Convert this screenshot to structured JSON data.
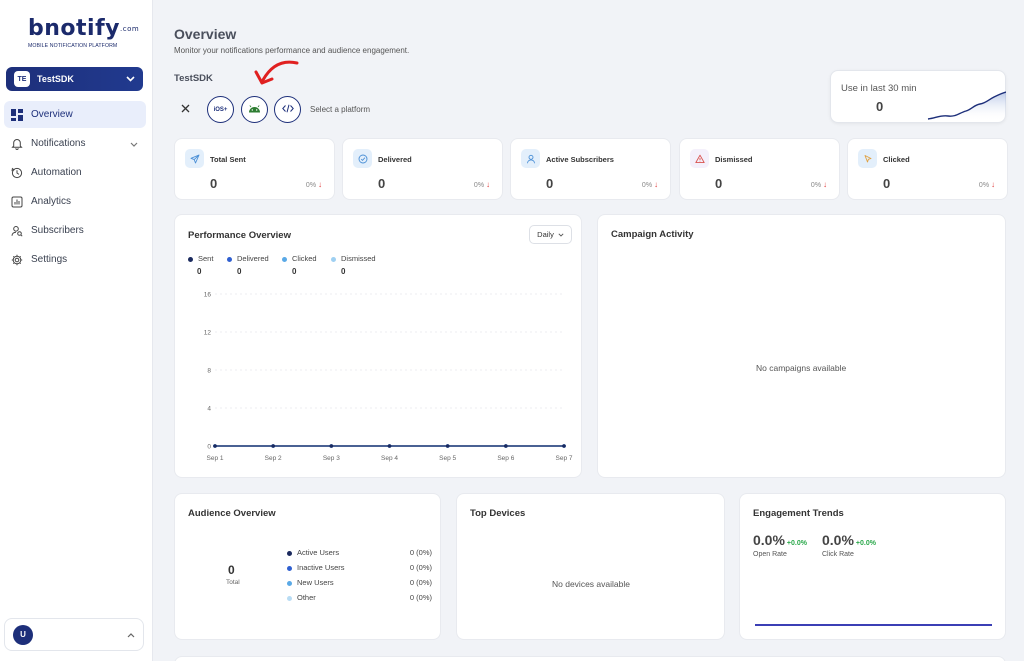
{
  "brand": {
    "logo_text": "bnotify",
    "logo_com": ".com",
    "tagline": "MOBILE NOTIFICATION PLATFORM"
  },
  "workspace": {
    "initials": "TE",
    "name": "TestSDK"
  },
  "nav": [
    {
      "label": "Overview",
      "icon": "dashboard-icon",
      "active": true
    },
    {
      "label": "Notifications",
      "icon": "bell-icon"
    },
    {
      "label": "Automation",
      "icon": "automation-icon"
    },
    {
      "label": "Analytics",
      "icon": "analytics-icon"
    },
    {
      "label": "Subscribers",
      "icon": "subscribers-icon"
    },
    {
      "label": "Settings",
      "icon": "gear-icon"
    }
  ],
  "user": {
    "initial": "U"
  },
  "header": {
    "title": "Overview",
    "subtitle": "Monitor your notifications performance and audience engagement.",
    "app_name": "TestSDK"
  },
  "platforms": {
    "ios_label": "iOS+",
    "select_label": "Select a platform"
  },
  "usage": {
    "label": "Use in last 30 min",
    "value": "0"
  },
  "stats": [
    {
      "label": "Total Sent",
      "value": "0",
      "change": "0%",
      "icon": "send-icon"
    },
    {
      "label": "Delivered",
      "value": "0",
      "change": "0%",
      "icon": "check-circle-icon"
    },
    {
      "label": "Active Subscribers",
      "value": "0",
      "change": "0%",
      "icon": "user-icon"
    },
    {
      "label": "Dismissed",
      "value": "0",
      "change": "0%",
      "icon": "warning-icon"
    },
    {
      "label": "Clicked",
      "value": "0",
      "change": "0%",
      "icon": "cursor-icon"
    }
  ],
  "performance": {
    "title": "Performance Overview",
    "period": "Daily",
    "legend": [
      {
        "name": "Sent",
        "value": "0",
        "color": "#1b2a5e"
      },
      {
        "name": "Delivered",
        "value": "0",
        "color": "#2f5fd0"
      },
      {
        "name": "Clicked",
        "value": "0",
        "color": "#5aa9e6"
      },
      {
        "name": "Dismissed",
        "value": "0",
        "color": "#9fd0f2"
      }
    ]
  },
  "chart_data": {
    "type": "line",
    "x": [
      "Sep 1",
      "Sep 2",
      "Sep 3",
      "Sep 4",
      "Sep 5",
      "Sep 6",
      "Sep 7"
    ],
    "series": [
      {
        "name": "Sent",
        "values": [
          0,
          0,
          0,
          0,
          0,
          0,
          0
        ]
      },
      {
        "name": "Delivered",
        "values": [
          0,
          0,
          0,
          0,
          0,
          0,
          0
        ]
      },
      {
        "name": "Clicked",
        "values": [
          0,
          0,
          0,
          0,
          0,
          0,
          0
        ]
      },
      {
        "name": "Dismissed",
        "values": [
          0,
          0,
          0,
          0,
          0,
          0,
          0
        ]
      }
    ],
    "yticks": [
      "0",
      "4",
      "8",
      "12",
      "16"
    ],
    "ylim": [
      0,
      16
    ],
    "grid": true
  },
  "campaign": {
    "title": "Campaign Activity",
    "empty": "No campaigns available"
  },
  "audience": {
    "title": "Audience Overview",
    "total_value": "0",
    "total_label": "Total",
    "rows": [
      {
        "label": "Active Users",
        "value": "0 (0%)",
        "color": "#1b2a5e"
      },
      {
        "label": "Inactive Users",
        "value": "0 (0%)",
        "color": "#2f5fd0"
      },
      {
        "label": "New Users",
        "value": "0 (0%)",
        "color": "#5aa9e6"
      },
      {
        "label": "Other",
        "value": "0 (0%)",
        "color": "#b8dcf4"
      }
    ]
  },
  "devices": {
    "title": "Top Devices",
    "empty": "No devices available"
  },
  "engagement": {
    "title": "Engagement Trends",
    "open_rate": "0.0%",
    "open_change": "+0.0%",
    "open_label": "Open Rate",
    "click_rate": "0.0%",
    "click_change": "+0.0%",
    "click_label": "Click Rate"
  }
}
